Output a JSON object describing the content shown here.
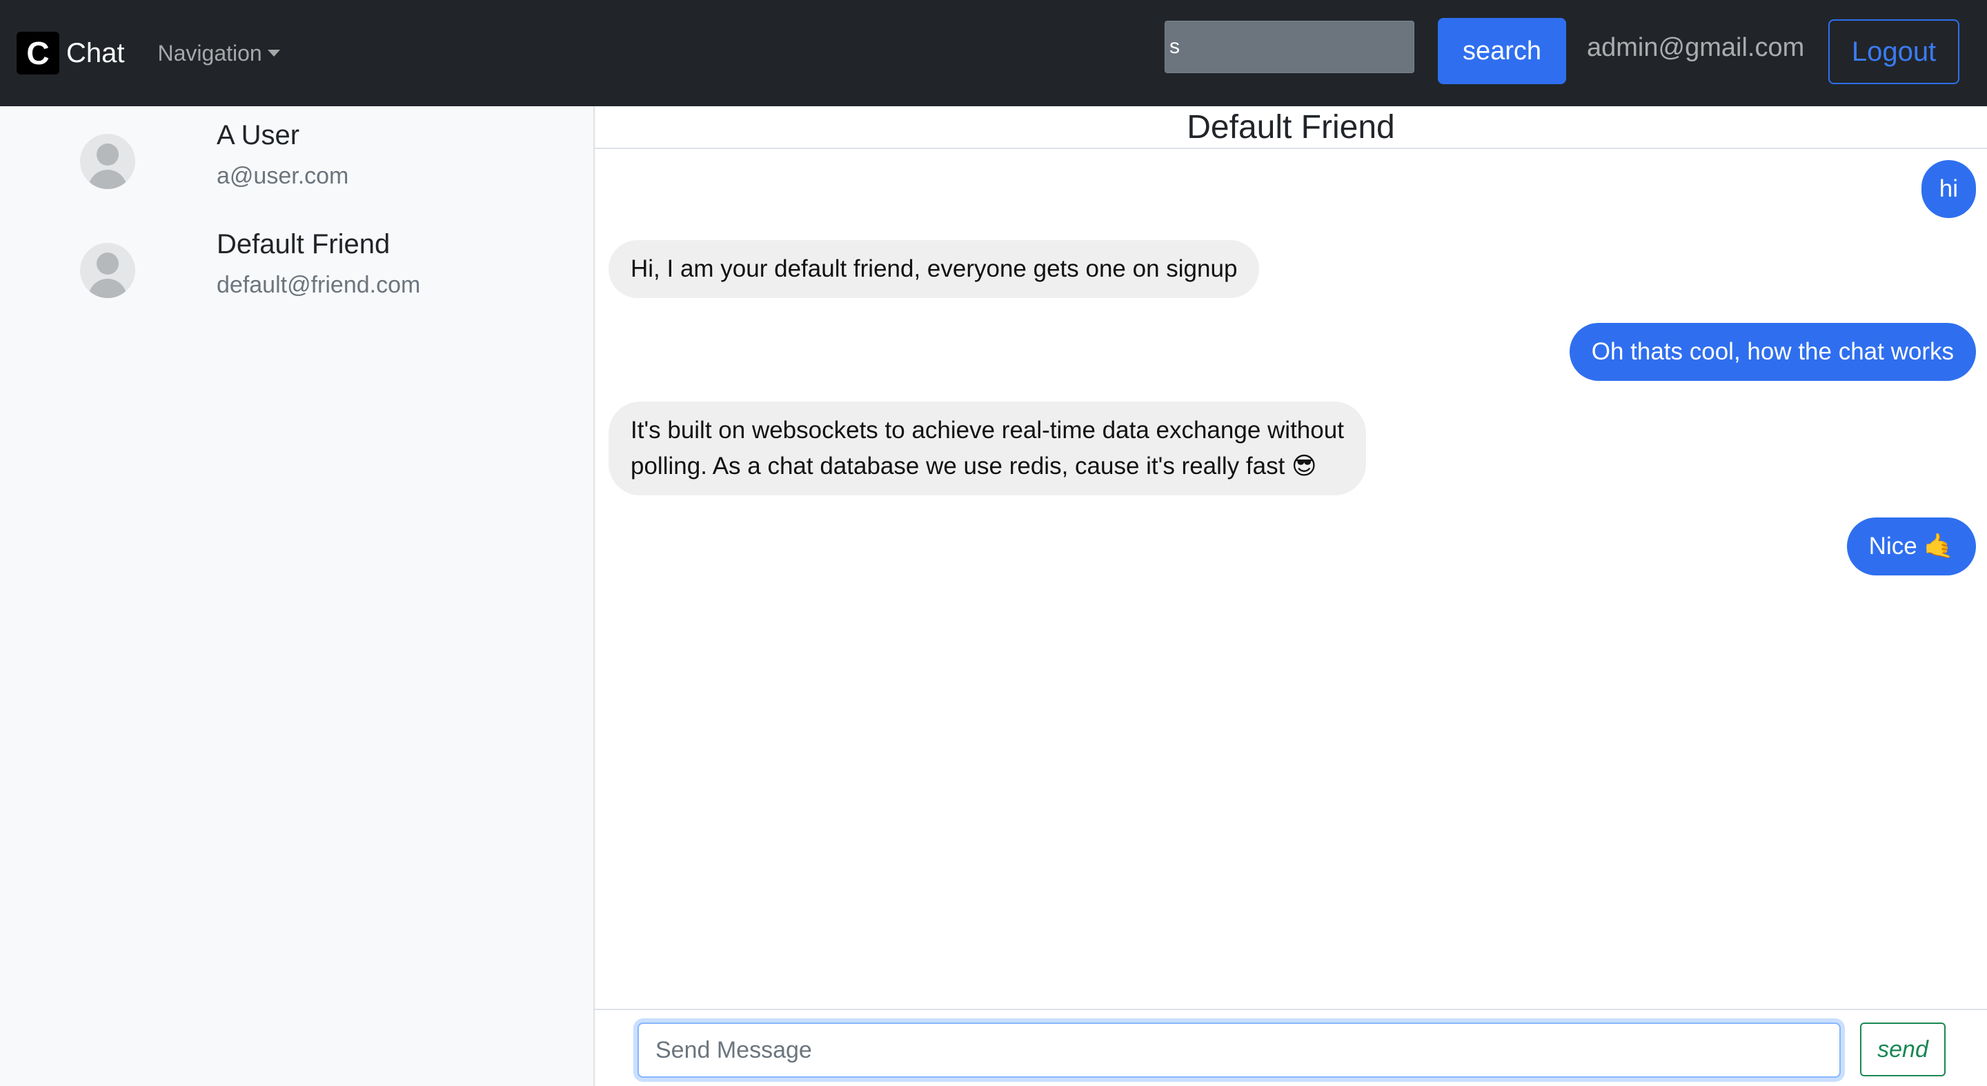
{
  "navbar": {
    "brand_letter": "C",
    "brand_name": "Chat",
    "navigation_label": "Navigation",
    "search_value": "s",
    "search_button_label": "search",
    "user_email": "admin@gmail.com",
    "logout_label": "Logout"
  },
  "sidebar": {
    "contacts": [
      {
        "name": "A User",
        "email": "a@user.com"
      },
      {
        "name": "Default Friend",
        "email": "default@friend.com"
      }
    ]
  },
  "chat": {
    "title": "Default Friend",
    "messages": [
      {
        "direction": "out",
        "text": "hi"
      },
      {
        "direction": "in",
        "text": "Hi, I am your default friend, everyone gets one on signup"
      },
      {
        "direction": "out",
        "text": "Oh thats cool, how the chat works"
      },
      {
        "direction": "in",
        "line1": "It's built on websockets to achieve real-time data exchange without",
        "line2": "polling. As a chat database we use redis, cause it's really fast 😎"
      },
      {
        "direction": "out",
        "text": "Nice 🤙"
      }
    ],
    "composer": {
      "placeholder": "Send Message",
      "send_label": "send"
    }
  },
  "colors": {
    "navbar_bg": "#212529",
    "primary": "#2f6fef",
    "success": "#198754",
    "sidebar_bg": "#f8f9fa",
    "incoming_bubble": "#efefef"
  }
}
